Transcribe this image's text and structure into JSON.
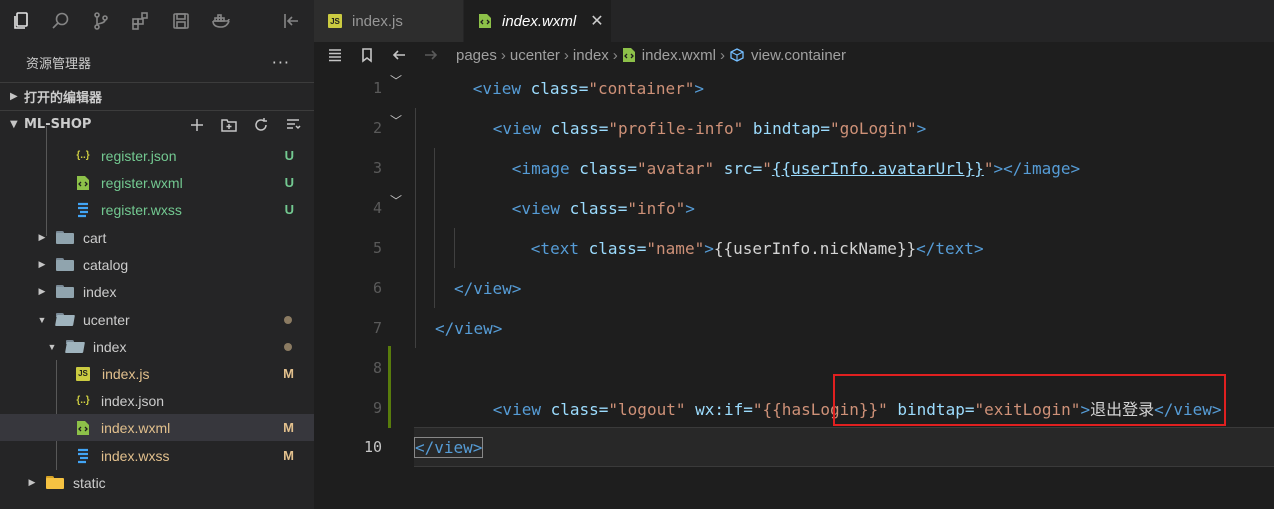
{
  "activity_bar": {
    "icons": [
      "explorer-icon",
      "search-icon",
      "source-control-icon",
      "extensions-icon",
      "save-icon",
      "docker-icon",
      "collapse-panel-icon"
    ]
  },
  "sidebar": {
    "title": "资源管理器",
    "more": "···",
    "open_editors": "打开的编辑器",
    "project": "ML-SHOP",
    "tree": [
      {
        "label": "register.json",
        "icon": "json",
        "status": "U"
      },
      {
        "label": "register.wxml",
        "icon": "wxml",
        "status": "U"
      },
      {
        "label": "register.wxss",
        "icon": "wxss",
        "status": "U"
      },
      {
        "label": "cart",
        "icon": "folder"
      },
      {
        "label": "catalog",
        "icon": "folder"
      },
      {
        "label": "index",
        "icon": "folder"
      },
      {
        "label": "ucenter",
        "icon": "folder-open",
        "status": "•"
      },
      {
        "label": "index",
        "icon": "folder-open",
        "status": "•"
      },
      {
        "label": "index.js",
        "icon": "js",
        "status": "M"
      },
      {
        "label": "index.json",
        "icon": "json",
        "status": ""
      },
      {
        "label": "index.wxml",
        "icon": "wxml",
        "status": "M"
      },
      {
        "label": "index.wxss",
        "icon": "wxss",
        "status": "M"
      },
      {
        "label": "static",
        "icon": "folder-static"
      }
    ]
  },
  "tabs": [
    {
      "label": "index.js",
      "icon": "js"
    },
    {
      "label": "index.wxml",
      "icon": "wxml",
      "close": "✕"
    }
  ],
  "breadcrumb": {
    "parts": [
      "pages",
      "ucenter",
      "index",
      "index.wxml",
      "view.container"
    ],
    "sep": "›"
  },
  "editor": {
    "line_numbers": [
      "1",
      "2",
      "3",
      "4",
      "5",
      "6",
      "7",
      "8",
      "9",
      "10"
    ],
    "lines": {
      "l1": [
        "<view",
        " class=",
        "\"container\"",
        ">"
      ],
      "l2": [
        "<view",
        " class=",
        "\"profile-info\"",
        " bindtap=",
        "\"goLogin\"",
        ">"
      ],
      "l3": [
        "<image",
        " class=",
        "\"avatar\"",
        " src=",
        "\"",
        "{{userInfo.avatarUrl}}",
        "\"",
        "></image>"
      ],
      "l4": [
        "<view",
        " class=",
        "\"info\"",
        ">"
      ],
      "l5": [
        "<text",
        " class=",
        "\"name\"",
        ">",
        "{{userInfo.nickName}}",
        "</text>"
      ],
      "l6": [
        "</view>"
      ],
      "l7": [
        "</view>"
      ],
      "l9": [
        "<view",
        " class=",
        "\"logout\"",
        " wx:if=",
        "\"{{hasLogin}}\"",
        " bindtap=",
        "\"exitLogin\"",
        ">",
        "退出登录",
        "</view>"
      ],
      "l10": [
        "</view>"
      ]
    }
  }
}
